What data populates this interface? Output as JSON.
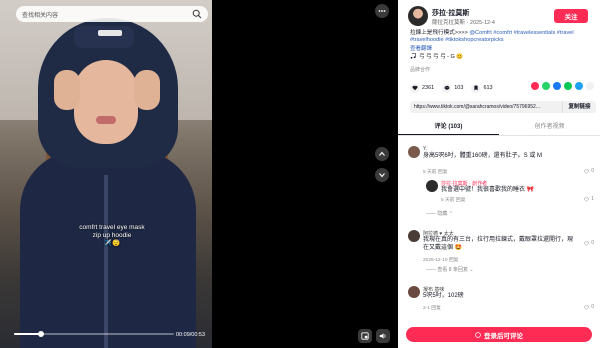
{
  "video": {
    "search_placeholder": "查找相关内容",
    "caption_line1": "comfrt travel eye mask",
    "caption_line2": "zip up hoodie",
    "caption_line3": "✈️😴",
    "time": "00:09/00:53",
    "progress": 0.17
  },
  "author": {
    "name": "莎拉·拉莫斯",
    "sub": "薩拉克拉莫斯 · 2025-12-4",
    "follow_label": "关注"
  },
  "post": {
    "desc_plain": "拉鍊上是飛行模式>>>> ",
    "desc_tags": "@Comfrt #comfrt #travelessentials #travel #travelhoodie #tiktokshopcreatorpicks",
    "translate": "查看翻譯",
    "music": "弓 弓 弓 弓 - G 😊",
    "brand": "品牌合作"
  },
  "stats": {
    "likes": "2361",
    "comments": "103",
    "saves": "613"
  },
  "share": {
    "colors": [
      "#fe2c55",
      "#25d366",
      "#1877f2",
      "#06c755",
      "#1da1f2",
      "#f1f1f2"
    ]
  },
  "link": {
    "url": "https://www.tiktok.com/@sarahcramos/video/75796952...",
    "copy_label": "复制链接"
  },
  "tabs": {
    "comments": "评论 (103)",
    "creator_videos": "创作者视频"
  },
  "comments": [
    {
      "name": "Y.",
      "text": "身高5呎6吋，體重160磅，還有肚子。S 或 M",
      "meta": "5 天前    回复",
      "likes": "0",
      "avatar_color": "#7a5a4a"
    },
    {
      "name": "莎拉·拉莫斯 · 創作者",
      "text": "我會選中號！我很喜歡我的睡衣 🎀",
      "meta": "5 天前    回复",
      "likes": "1",
      "avatar_color": "#2a2a2a"
    },
    {
      "name": "阿拉德 ♥ 太太",
      "text": "我現在真的有三台，拉行用拉鍊式，戴眼罩拉還開行，現在又戴這個 🤩",
      "meta": "2025-12-10    回复",
      "likes": "0",
      "avatar_color": "#4a3c36"
    },
    {
      "name": "凝布 基味",
      "text": "5呎5吋，102磅",
      "meta": "2-1    回复",
      "likes": "0",
      "avatar_color": "#6b4a3f"
    }
  ],
  "replies": {
    "hide_label": "隐藏",
    "view_more_label": "查看 8 条回复"
  },
  "bottom": {
    "login_label": "登录后可评论"
  }
}
